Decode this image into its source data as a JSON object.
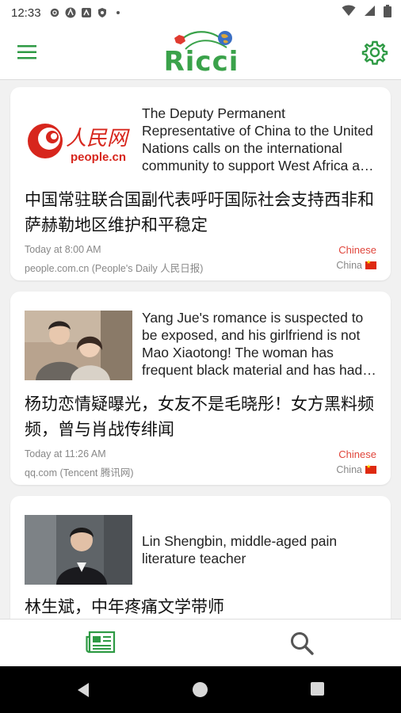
{
  "status_bar": {
    "time": "12:33"
  },
  "app": {
    "logo_text": "Ricci",
    "brand_color": "#3aa24a"
  },
  "articles": [
    {
      "thumb_text": "人民网",
      "thumb_subtext": "people.cn",
      "title_en": "The Deputy Permanent Representative of China to the United Nations calls on the international community to support West Africa and the Sahel region to maintain and stabilize",
      "title_zh": "中国常驻联合国副代表呼吁国际社会支持西非和萨赫勒地区维护和平稳定",
      "time": "Today at 8:00 AM",
      "source": "people.com.cn (People's Daily 人民日报)",
      "language": "Chinese",
      "country": "China"
    },
    {
      "title_en": "Yang Jue's romance is suspected to be exposed, and his girlfriend is not Mao Xiaotong! The woman has frequent black material and has had rumors with Xiao Zhan",
      "title_zh": "杨玏恋情疑曝光，女友不是毛晓彤！女方黑料频频，曾与肖战传绯闻",
      "time": "Today at 11:26 AM",
      "source": "qq.com (Tencent 腾讯网)",
      "language": "Chinese",
      "country": "China"
    },
    {
      "title_en": "Lin Shengbin, middle-aged pain literature teacher",
      "title_zh": "林生斌，中年疼痛文学带师"
    }
  ],
  "colors": {
    "accent_green": "#2e9a44",
    "language_red": "#e0453b",
    "meta_gray": "#888888"
  }
}
